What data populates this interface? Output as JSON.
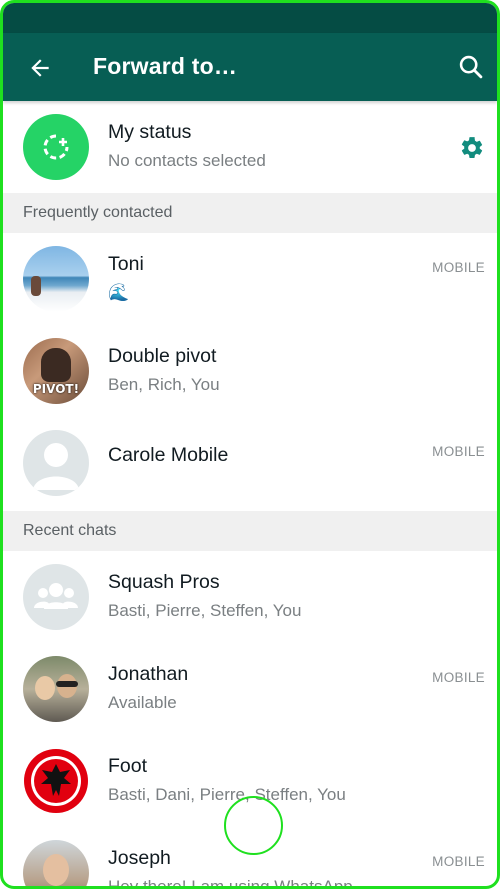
{
  "header": {
    "title": "Forward to…"
  },
  "status": {
    "name": "My status",
    "subtitle": "No contacts selected"
  },
  "sections": {
    "frequent": "Frequently contacted",
    "recent": "Recent chats"
  },
  "frequent": [
    {
      "name": "Toni",
      "subtitle": "🌊",
      "tag": "MOBILE"
    },
    {
      "name": "Double pivot",
      "subtitle": "Ben, Rich, You",
      "tag": "",
      "avatar_text": "PIVOT!"
    },
    {
      "name": "Carole Mobile",
      "subtitle": "",
      "tag": "MOBILE"
    }
  ],
  "recent": [
    {
      "name": "Squash Pros",
      "subtitle": "Basti, Pierre, Steffen, You",
      "tag": ""
    },
    {
      "name": "Jonathan",
      "subtitle": "Available",
      "tag": "MOBILE"
    },
    {
      "name": "Foot",
      "subtitle": "Basti, Dani, Pierre, Steffen, You",
      "tag": ""
    },
    {
      "name": "Joseph",
      "subtitle": "Hey there! I am using WhatsApp.",
      "tag": "MOBILE"
    }
  ],
  "colors": {
    "header": "#075e54",
    "statusbar": "#054c44",
    "accent": "#25d366",
    "teal": "#128c7e"
  }
}
